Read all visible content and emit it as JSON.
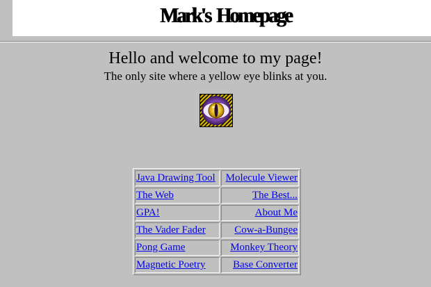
{
  "banner": {
    "title": "Mark's  Homepage"
  },
  "welcome": {
    "heading": "Hello and welcome to my page!",
    "subheading": "The only site where a yellow eye blinks at you."
  },
  "eye_image": {
    "icon": "yellow-eye-icon",
    "colors": {
      "iris": "#e8c020",
      "ring": "#8a4fc0",
      "pupil": "#2a1028"
    }
  },
  "links": [
    {
      "left": "Java Drawing Tool",
      "right": "Molecule Viewer"
    },
    {
      "left": "The Web",
      "right": "The Best..."
    },
    {
      "left": "GPA!",
      "right": "About Me"
    },
    {
      "left": "The Vader Fader",
      "right": "Cow-a-Bungee"
    },
    {
      "left": "Pong Game",
      "right": "Monkey Theory"
    },
    {
      "left": "Magnetic Poetry",
      "right": "Base Converter"
    }
  ],
  "colors": {
    "background": "#c0c0c0",
    "link": "#0000ee",
    "banner": "#ffffff"
  }
}
